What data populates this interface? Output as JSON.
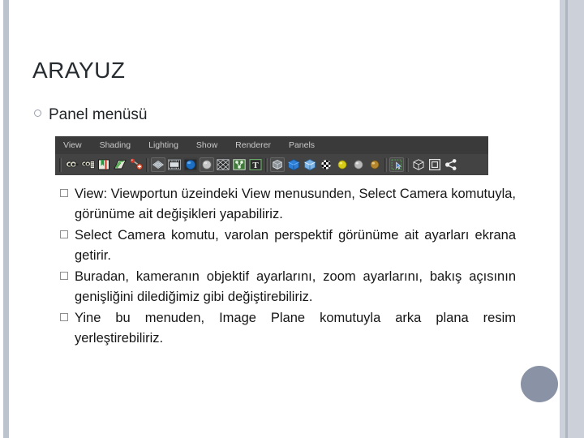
{
  "slide": {
    "title": "ARAYUZ",
    "level1": {
      "bullet_icon": "hollow-circle-bullet",
      "label": "Panel menüsü"
    },
    "bullets": [
      {
        "bullet_icon": "hollow-square-bullet",
        "text": "View: Viewportun üzeindeki View menusunden, Select Camera komutuyla, görünüme ait değişikleri yapabiliriz."
      },
      {
        "bullet_icon": "hollow-square-bullet",
        "text": "Select Camera komutu, varolan perspektif görünüme ait ayarları ekrana getirir."
      },
      {
        "bullet_icon": "hollow-square-bullet",
        "text": "Buradan, kameranın objektif ayarlarını, zoom ayarlarını, bakış açısının genişliğini dilediğimiz gibi değiştirebiliriz."
      },
      {
        "bullet_icon": "hollow-square-bullet",
        "text": "Yine bu menuden, Image Plane komutuyla arka plana resim yerleştirebiliriz."
      }
    ]
  },
  "maya_panel": {
    "menu_items": [
      {
        "label": "View"
      },
      {
        "label": "Shading"
      },
      {
        "label": "Lighting"
      },
      {
        "label": "Show"
      },
      {
        "label": "Renderer"
      },
      {
        "label": "Panels"
      }
    ],
    "icons": [
      {
        "name": "select-camera-icon"
      },
      {
        "name": "camera-attributes-icon"
      },
      {
        "name": "bookmark-icon"
      },
      {
        "name": "paint-effects-icon"
      },
      {
        "name": "image-plane-icon"
      },
      {
        "name": "wireframe-shading-icon"
      },
      {
        "name": "smooth-shade-all-icon"
      },
      {
        "name": "smooth-shade-textured-icon"
      },
      {
        "name": "use-default-material-icon"
      },
      {
        "name": "shade-options-icon"
      },
      {
        "name": "xray-joints-icon"
      },
      {
        "name": "texture-mode-icon"
      },
      {
        "name": "isolate-select-icon"
      },
      {
        "name": "toggle-nurbs-icon"
      },
      {
        "name": "toggle-polygons-icon"
      },
      {
        "name": "toggle-subdiv-icon"
      },
      {
        "name": "toggle-textures-icon"
      },
      {
        "name": "point-light-icon"
      },
      {
        "name": "default-light-icon"
      },
      {
        "name": "all-lights-icon"
      },
      {
        "name": "shadows-icon"
      },
      {
        "name": "grid-toggle-icon"
      },
      {
        "name": "film-gate-icon"
      },
      {
        "name": "exposure-icon"
      }
    ]
  },
  "decorations": {
    "left_bar_color": "#bcc3cd",
    "right_bar_color": "#ccd1d9",
    "right_line_color": "#aeb6c2",
    "circle_color": "#8a93a6",
    "panel_background": "#3a3a3a"
  }
}
